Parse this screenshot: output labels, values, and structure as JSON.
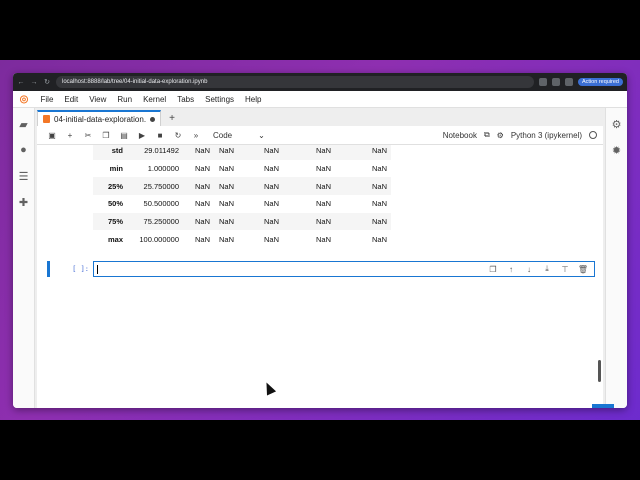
{
  "browser": {
    "back": "←",
    "forward": "→",
    "reload": "↻",
    "url": "localhost:8888/lab/tree/04-initial-data-exploration.ipynb",
    "action_label": "Action required"
  },
  "menubar": {
    "items": [
      "File",
      "Edit",
      "View",
      "Run",
      "Kernel",
      "Tabs",
      "Settings",
      "Help"
    ]
  },
  "tab": {
    "title": "04-initial-data-exploration.",
    "add": "+"
  },
  "toolbar": {
    "cell_type": "Code",
    "dropdown_arrow": "⌄",
    "notebook_label": "Notebook",
    "kernel_name": "Python 3 (ipykernel)"
  },
  "table": {
    "rows": [
      {
        "label": "std",
        "values": [
          "29.011492",
          "NaN",
          "NaN",
          "NaN",
          "NaN",
          "NaN"
        ]
      },
      {
        "label": "min",
        "values": [
          "1.000000",
          "NaN",
          "NaN",
          "NaN",
          "NaN",
          "NaN"
        ]
      },
      {
        "label": "25%",
        "values": [
          "25.750000",
          "NaN",
          "NaN",
          "NaN",
          "NaN",
          "NaN"
        ]
      },
      {
        "label": "50%",
        "values": [
          "50.500000",
          "NaN",
          "NaN",
          "NaN",
          "NaN",
          "NaN"
        ]
      },
      {
        "label": "75%",
        "values": [
          "75.250000",
          "NaN",
          "NaN",
          "NaN",
          "NaN",
          "NaN"
        ]
      },
      {
        "label": "max",
        "values": [
          "100.000000",
          "NaN",
          "NaN",
          "NaN",
          "NaN",
          "NaN"
        ]
      }
    ]
  },
  "cell": {
    "prompt": "[ ]:"
  },
  "colors": {
    "accent": "#1976d2",
    "jupyter_orange": "#f37726",
    "background_gradient": "#7a2a9a"
  }
}
